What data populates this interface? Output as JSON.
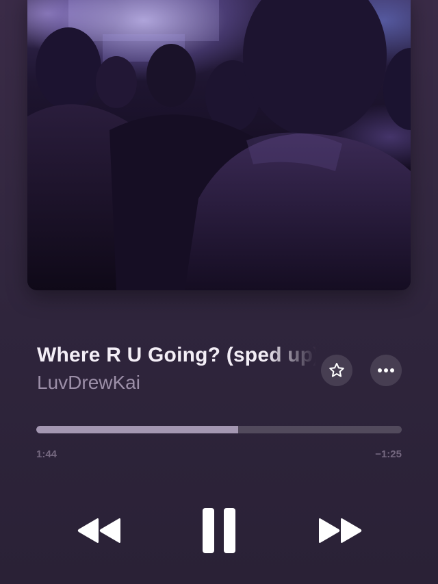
{
  "artwork": {
    "icon": "concert-crowd-artwork"
  },
  "track": {
    "title": "Where R U Going? (sped up)",
    "artist": "LuvDrewKai"
  },
  "actions": {
    "favorite_icon": "star-icon",
    "more_icon": "ellipsis-icon"
  },
  "progress": {
    "elapsed": "1:44",
    "remaining": "−1:25",
    "fraction": 0.552
  },
  "controls": {
    "previous_icon": "rewind-icon",
    "play_pause_icon": "pause-icon",
    "next_icon": "fast-forward-icon"
  },
  "colors": {
    "background": "#2f253c",
    "progress_fill": "#a497b2",
    "title": "#f3eef6",
    "artist": "#9c8fa8"
  }
}
